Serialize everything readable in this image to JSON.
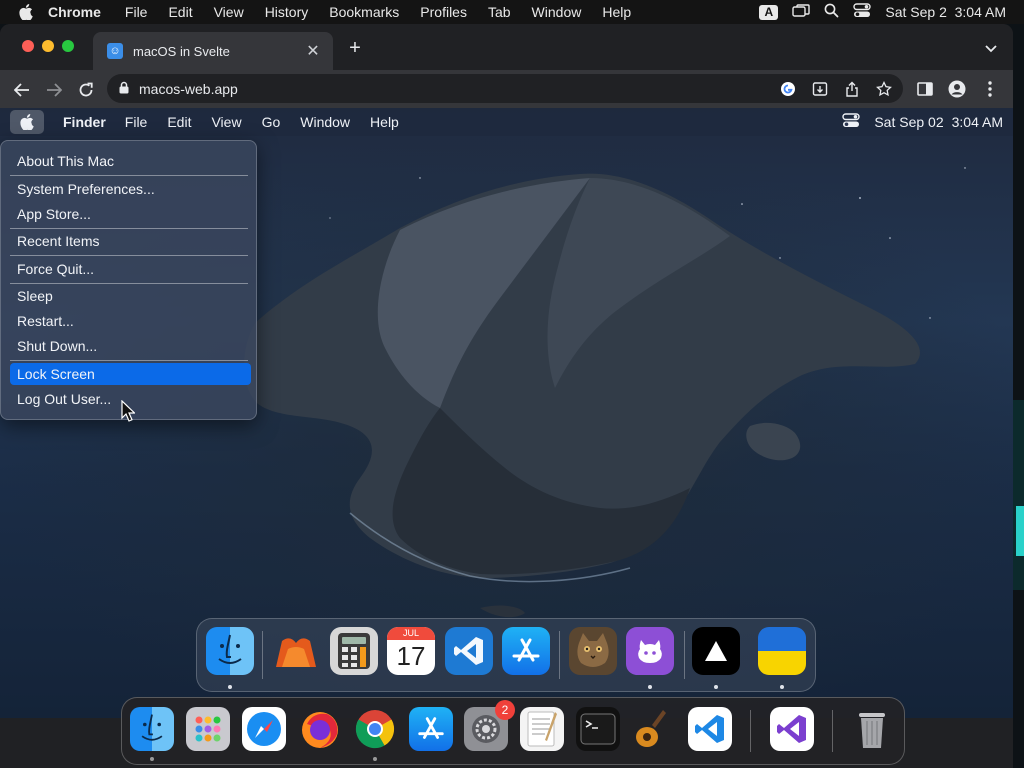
{
  "host_menubar": {
    "app_name": "Chrome",
    "menus": [
      "File",
      "Edit",
      "View",
      "History",
      "Bookmarks",
      "Profiles",
      "Tab",
      "Window",
      "Help"
    ],
    "input_source": "A",
    "datetime": "Sat Sep 2  3:04 AM"
  },
  "chrome": {
    "tab_title": "macOS in Svelte",
    "url": "macos-web.app"
  },
  "web_menubar": {
    "app_name": "Finder",
    "menus": [
      "File",
      "Edit",
      "View",
      "Go",
      "Window",
      "Help"
    ],
    "datetime": "Sat Sep 02",
    "time": "3:04 AM"
  },
  "apple_menu": {
    "items": [
      "About This Mac",
      "System Preferences...",
      "App Store...",
      "Recent Items",
      "Force Quit...",
      "Sleep",
      "Restart...",
      "Shut Down...",
      "Lock Screen",
      "Log Out User..."
    ],
    "highlighted": "Lock Screen"
  },
  "inner_dock": {
    "calendar_month": "JUL",
    "calendar_day": "17"
  },
  "host_dock": {
    "system_prefs_badge": "2"
  },
  "colors": {
    "accent_blue": "#0b6ae8",
    "badge_red": "#f0403a",
    "chrome_dark": "#202124"
  }
}
